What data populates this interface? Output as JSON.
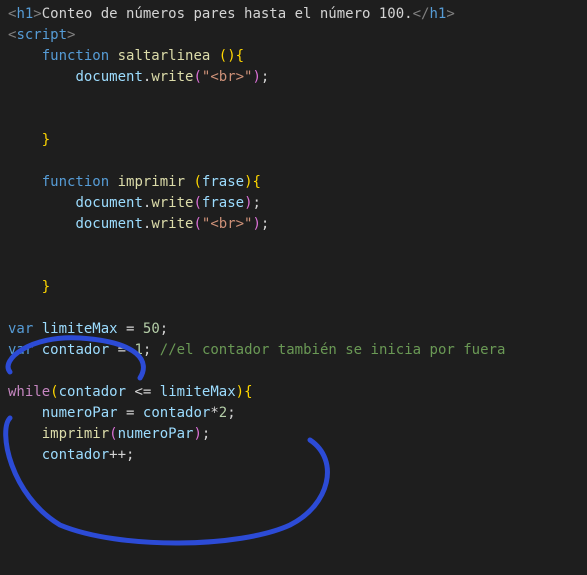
{
  "code": {
    "l1": {
      "h1_open_lt": "<",
      "h1_open_name": "h1",
      "h1_open_gt": ">",
      "h1_text": "Conteo de números pares hasta el número 100.",
      "h1_close_lt": "</",
      "h1_close_name": "h1",
      "h1_close_gt": ">"
    },
    "l2": {
      "script_open_lt": "<",
      "script_name": "script",
      "script_open_gt": ">"
    },
    "l3": {
      "indent": "    ",
      "function_kw": "function",
      "space": " ",
      "name": "saltarlinea",
      "space2": " ",
      "paren_open": "(",
      "paren_close": ")",
      "brace_open": "{"
    },
    "l4": {
      "indent": "        ",
      "obj": "document",
      "dot": ".",
      "method": "write",
      "paren_open": "(",
      "str": "\"<br>\"",
      "paren_close": ")",
      "semi": ";"
    },
    "l7": {
      "indent": "    ",
      "brace_close": "}"
    },
    "l9": {
      "indent": "    ",
      "function_kw": "function",
      "space": " ",
      "name": "imprimir",
      "space2": " ",
      "paren_open": "(",
      "param": "frase",
      "paren_close": ")",
      "brace_open": "{"
    },
    "l10": {
      "indent": "        ",
      "obj": "document",
      "dot": ".",
      "method": "write",
      "paren_open": "(",
      "arg": "frase",
      "paren_close": ")",
      "semi": ";"
    },
    "l11": {
      "indent": "        ",
      "obj": "document",
      "dot": ".",
      "method": "write",
      "paren_open": "(",
      "str": "\"<br>\"",
      "paren_close": ")",
      "semi": ";"
    },
    "l14": {
      "indent": "    ",
      "brace_close": "}"
    },
    "l16": {
      "var_kw": "var",
      "space": " ",
      "name": "limiteMax",
      "space2": " ",
      "eq": "=",
      "space3": " ",
      "num": "50",
      "semi": ";"
    },
    "l17": {
      "var_kw": "var",
      "space": " ",
      "name": "contador",
      "space2": " ",
      "eq": "=",
      "space3": " ",
      "num": "1",
      "semi": ";",
      "space4": " ",
      "comment": "//el contador también se inicia por fuera"
    },
    "l19": {
      "while_kw": "while",
      "paren_open": "(",
      "var1": "contador",
      "space": " ",
      "op": "<=",
      "space2": " ",
      "var2": "limiteMax",
      "paren_close": ")",
      "brace_open": "{"
    },
    "l20": {
      "indent": "    ",
      "varname": "numeroPar",
      "space": " ",
      "eq": "=",
      "space2": " ",
      "var2": "contador",
      "op": "*",
      "num": "2",
      "semi": ";"
    },
    "l21": {
      "indent": "    ",
      "func": "imprimir",
      "paren_open": "(",
      "arg": "numeroPar",
      "paren_close": ")",
      "semi": ";"
    },
    "l22": {
      "indent": "    ",
      "var": "contador",
      "op": "++",
      "semi": ";"
    }
  },
  "annotation": {
    "color": "#2c4bd6"
  }
}
